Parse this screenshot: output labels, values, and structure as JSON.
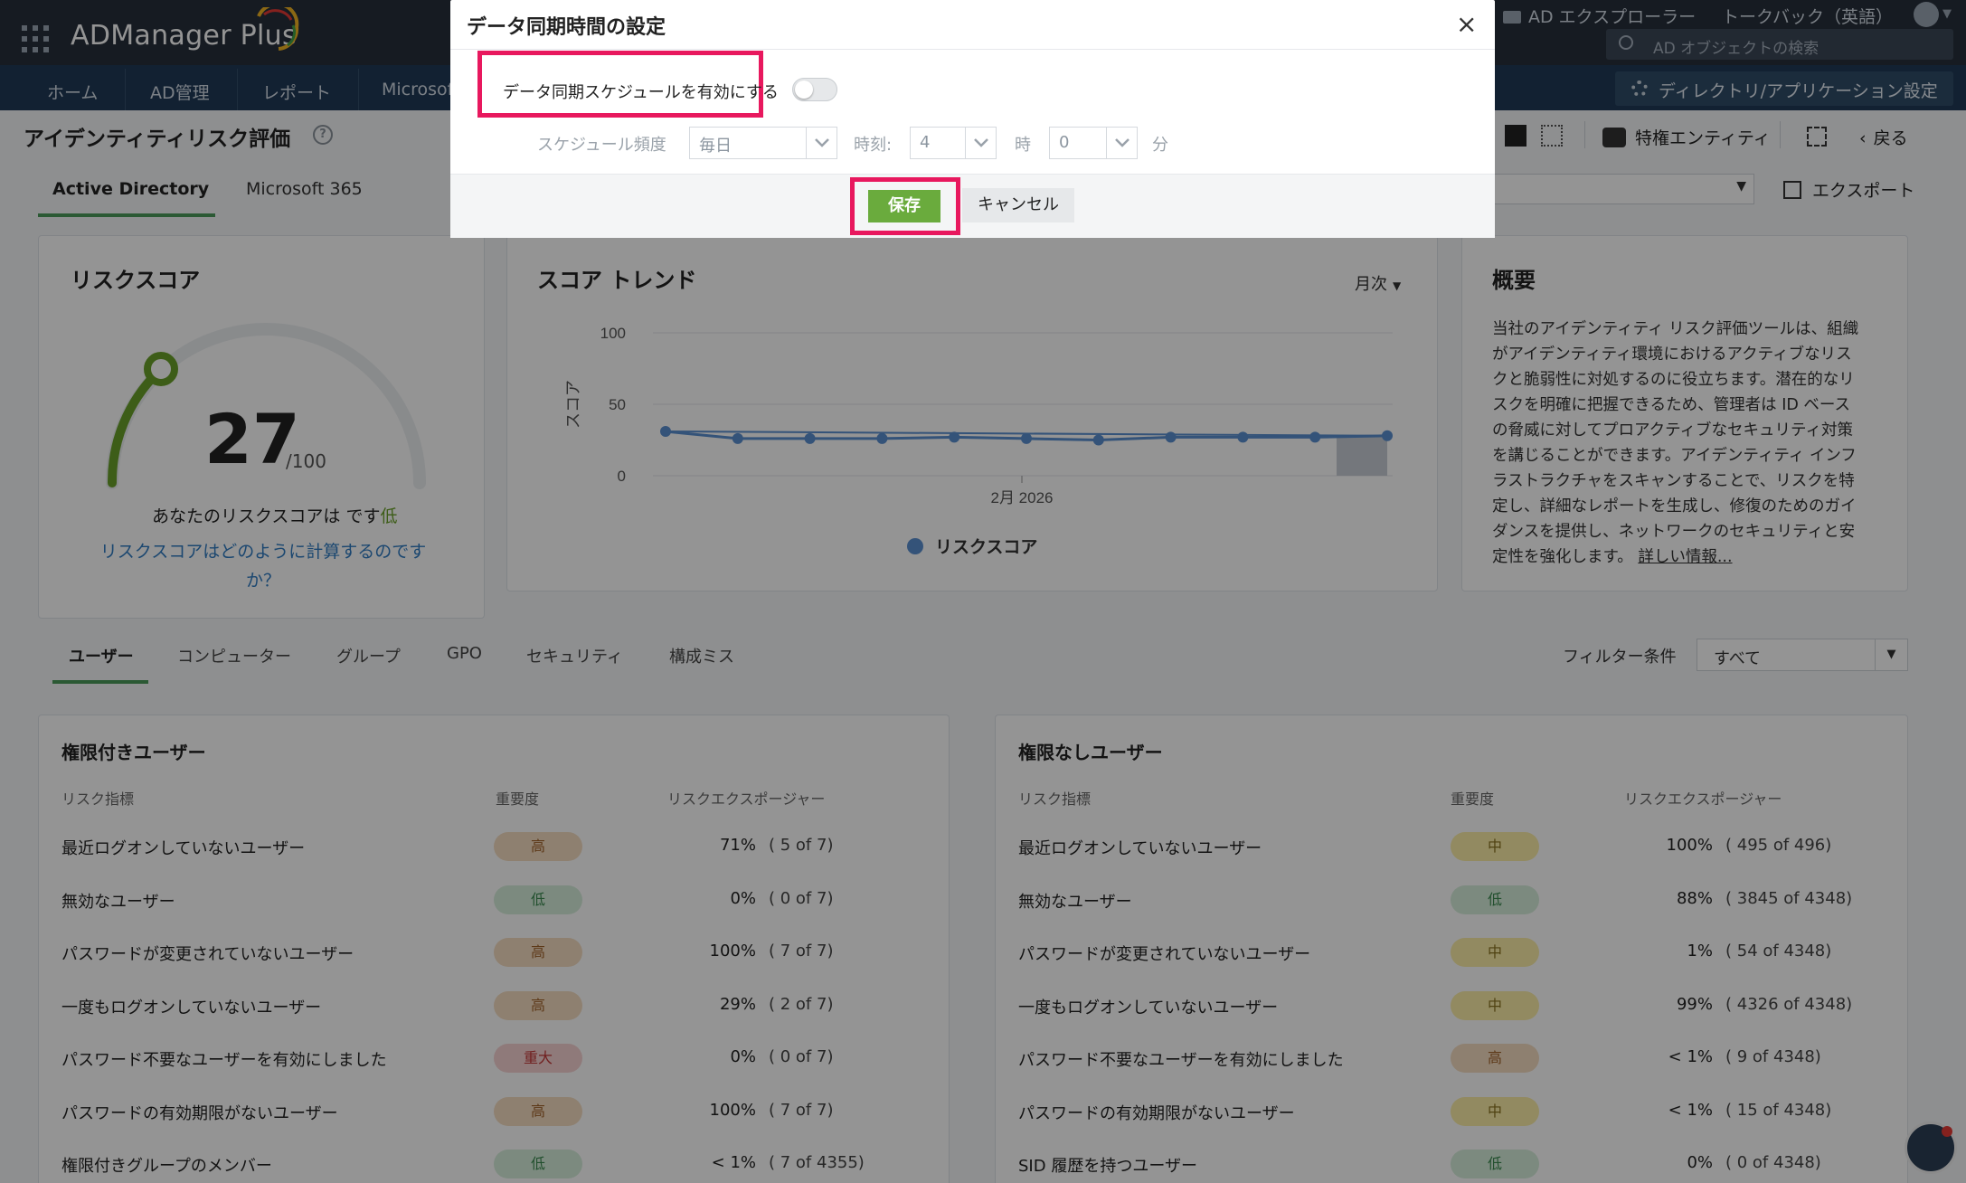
{
  "app": {
    "brand": "ADManager Plus",
    "accent": "#7cb342"
  },
  "topbar": {
    "ad_explorer": "AD エクスプローラー",
    "talkback": "トークバック（英語）",
    "search_placeholder": "AD オブジェクトの検索",
    "dir_settings": "ディレクトリ/アプリケーション設定"
  },
  "nav": {
    "tabs": [
      "ホーム",
      "AD管理",
      "レポート",
      "Microsof"
    ]
  },
  "page": {
    "title": "アイデンティティリスク評価",
    "privileged_entity": "特権エンティティ",
    "back": "戻る",
    "export": "エクスポート",
    "tabs": [
      "Active Directory",
      "Microsoft 365"
    ]
  },
  "risk": {
    "title": "リスクスコア",
    "score": "27",
    "out_of": "/100",
    "score_value": 27,
    "desc_prefix": "あなたのリスクスコアは です",
    "desc_level": "低",
    "link": "リスクスコアはどのように計算するのです",
    "link2": "か？"
  },
  "trend": {
    "title": "スコア トレンド",
    "period": "月次"
  },
  "chart_data": {
    "type": "line",
    "title": "スコア トレンド",
    "ylabel": "スコア",
    "xlabel": "2月 2026",
    "yticks": [
      "100",
      "50",
      "0"
    ],
    "ylim": [
      0,
      100
    ],
    "legend": "リスクスコア",
    "series": [
      {
        "name": "リスクスコア",
        "values": [
          31,
          26,
          26,
          26,
          27,
          26,
          25,
          27,
          27,
          27,
          28
        ]
      }
    ],
    "grid": true
  },
  "summary": {
    "title": "概要",
    "lines": [
      "当社のアイデンティティ リスク評価ツールは、組織",
      "がアイデンティティ環境におけるアクティブなリス",
      "クと脆弱性に対処するのに役立ちます。潜在的なリ",
      "スクを明確に把握できるため、管理者は ID ベース",
      "の脅威に対してプロアクティブなセキュリティ対策",
      "を講じることができます。アイデンティティ インフ",
      "ラストラクチャをスキャンすることで、リスクを特",
      "定し、詳細なレポートを生成し、修復のためのガイ",
      "ダンスを提供し、ネットワークのセキュリティと安"
    ],
    "last_line": "定性を強化します。",
    "more": "詳しい情報..."
  },
  "cat_tabs": [
    "ユーザー",
    "コンピューター",
    "グループ",
    "GPO",
    "セキュリティ",
    "構成ミス"
  ],
  "filter": {
    "label": "フィルター条件",
    "value": "すべて"
  },
  "priv": {
    "title": "権限付きユーザー",
    "cols": [
      "リスク指標",
      "重要度",
      "リスクエクスポージャー"
    ],
    "rows": [
      {
        "label": "最近ログオンしていないユーザー",
        "sev": "高",
        "cls": "high",
        "pct": "71%",
        "cnt": "( 5 of 7)"
      },
      {
        "label": "無効なユーザー",
        "sev": "低",
        "cls": "low",
        "pct": "0%",
        "cnt": "( 0 of 7)"
      },
      {
        "label": "パスワードが変更されていないユーザー",
        "sev": "高",
        "cls": "high",
        "pct": "100%",
        "cnt": "( 7 of 7)"
      },
      {
        "label": "一度もログオンしていないユーザー",
        "sev": "高",
        "cls": "high",
        "pct": "29%",
        "cnt": "( 2 of 7)"
      },
      {
        "label": "パスワード不要なユーザーを有効にしました",
        "sev": "重大",
        "cls": "crit",
        "pct": "0%",
        "cnt": "( 0 of 7)"
      },
      {
        "label": "パスワードの有効期限がないユーザー",
        "sev": "高",
        "cls": "high",
        "pct": "100%",
        "cnt": "( 7 of 7)"
      },
      {
        "label": "権限付きグループのメンバー",
        "sev": "低",
        "cls": "low",
        "pct": "< 1%",
        "cnt": "( 7 of 4355)"
      }
    ]
  },
  "nonpriv": {
    "title": "権限なしユーザー",
    "cols": [
      "リスク指標",
      "重要度",
      "リスクエクスポージャー"
    ],
    "rows": [
      {
        "label": "最近ログオンしていないユーザー",
        "sev": "中",
        "cls": "mid",
        "pct": "100%",
        "cnt": "( 495 of 496)"
      },
      {
        "label": "無効なユーザー",
        "sev": "低",
        "cls": "low",
        "pct": "88%",
        "cnt": "( 3845 of 4348)"
      },
      {
        "label": "パスワードが変更されていないユーザー",
        "sev": "中",
        "cls": "mid",
        "pct": "1%",
        "cnt": "( 54 of 4348)"
      },
      {
        "label": "一度もログオンしていないユーザー",
        "sev": "中",
        "cls": "mid",
        "pct": "99%",
        "cnt": "( 4326 of 4348)"
      },
      {
        "label": "パスワード不要なユーザーを有効にしました",
        "sev": "高",
        "cls": "high",
        "pct": "< 1%",
        "cnt": "( 9 of 4348)"
      },
      {
        "label": "パスワードの有効期限がないユーザー",
        "sev": "中",
        "cls": "mid",
        "pct": "< 1%",
        "cnt": "( 15 of 4348)"
      },
      {
        "label": "SID 履歴を持つユーザー",
        "sev": "低",
        "cls": "low",
        "pct": "0%",
        "cnt": "( 0 of 4348)"
      }
    ]
  },
  "modal": {
    "title": "データ同期時間の設定",
    "close": "×",
    "enable_label": "データ同期スケジュールを有効にする",
    "enabled": false,
    "freq_label": "スケジュール頻度",
    "freq_value": "毎日",
    "time_label": "時刻:",
    "hour_value": "4",
    "hour_unit": "時",
    "min_value": "0",
    "min_unit": "分",
    "save": "保存",
    "cancel": "キャンセル"
  }
}
